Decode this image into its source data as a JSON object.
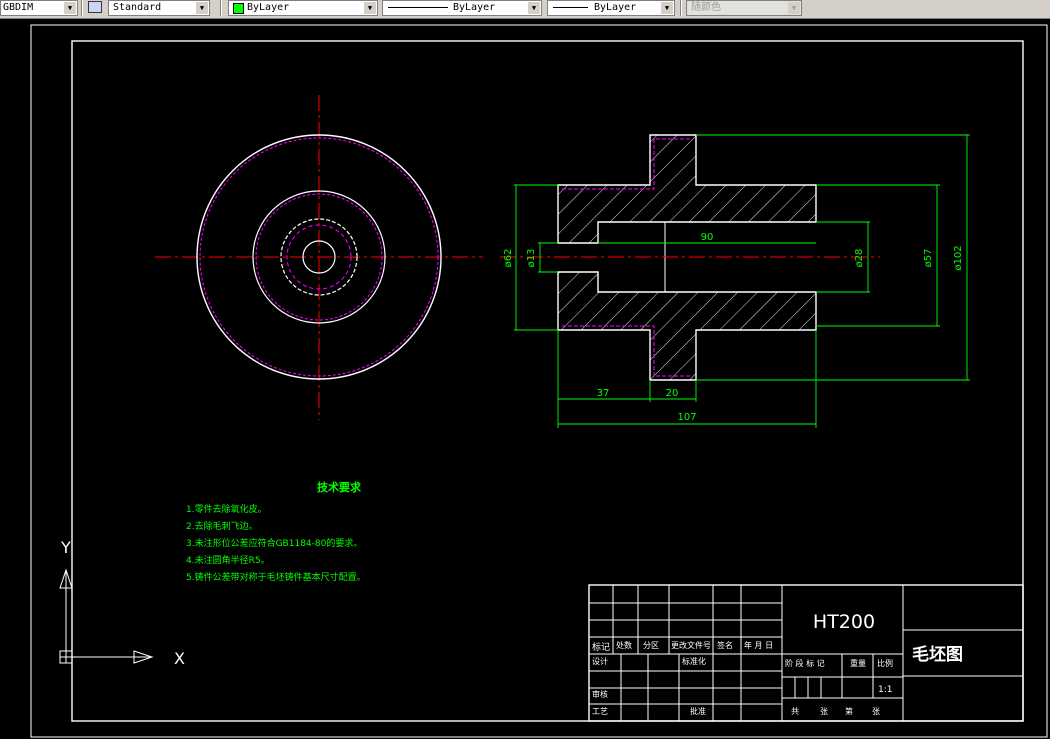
{
  "toolbar": {
    "dimstyle": "GBDIM",
    "textstyle": "Standard",
    "layer_color": "ByLayer",
    "linetype": "ByLayer",
    "lineweight": "ByLayer",
    "plotstyle": "随颜色"
  },
  "dimensions": {
    "d62": "ø62",
    "d13": "ø13",
    "len90": "90",
    "d28": "ø28",
    "d57": "ø57",
    "d102": "ø102",
    "len37": "37",
    "len20": "20",
    "len107": "107"
  },
  "tech_req": {
    "title": "技术要求",
    "items": [
      "1.零件去除氧化皮。",
      "2.去除毛刺飞边。",
      "3.未注形位公差应符合GB1184-80的要求。",
      "4.未注圆角半径R5。",
      "5.铸件公差带对称于毛坯铸件基本尺寸配置。"
    ]
  },
  "title_block": {
    "material": "HT200",
    "drawing_name": "毛坯图",
    "scale": "1:1",
    "labels": {
      "mark": "标记",
      "count": "处数",
      "zone": "分区",
      "change_doc": "更改文件号",
      "signature": "签名",
      "date": "年 月 日",
      "design": "设计",
      "standardize": "标准化",
      "review": "审核",
      "process": "工艺",
      "approve": "批准",
      "stage_mark": "阶 段 标 记",
      "weight": "重量",
      "ratio": "比例",
      "sheets": "共",
      "sheet": "张",
      "no": "第"
    }
  },
  "ucs": {
    "x": "X",
    "y": "Y"
  },
  "colors": {
    "outline": "#ffffff",
    "hatch": "#ffffff",
    "dimension": "#00ff00",
    "center": "#ff0000",
    "casting": "#ff00ff",
    "tech_text": "#00ff00"
  }
}
